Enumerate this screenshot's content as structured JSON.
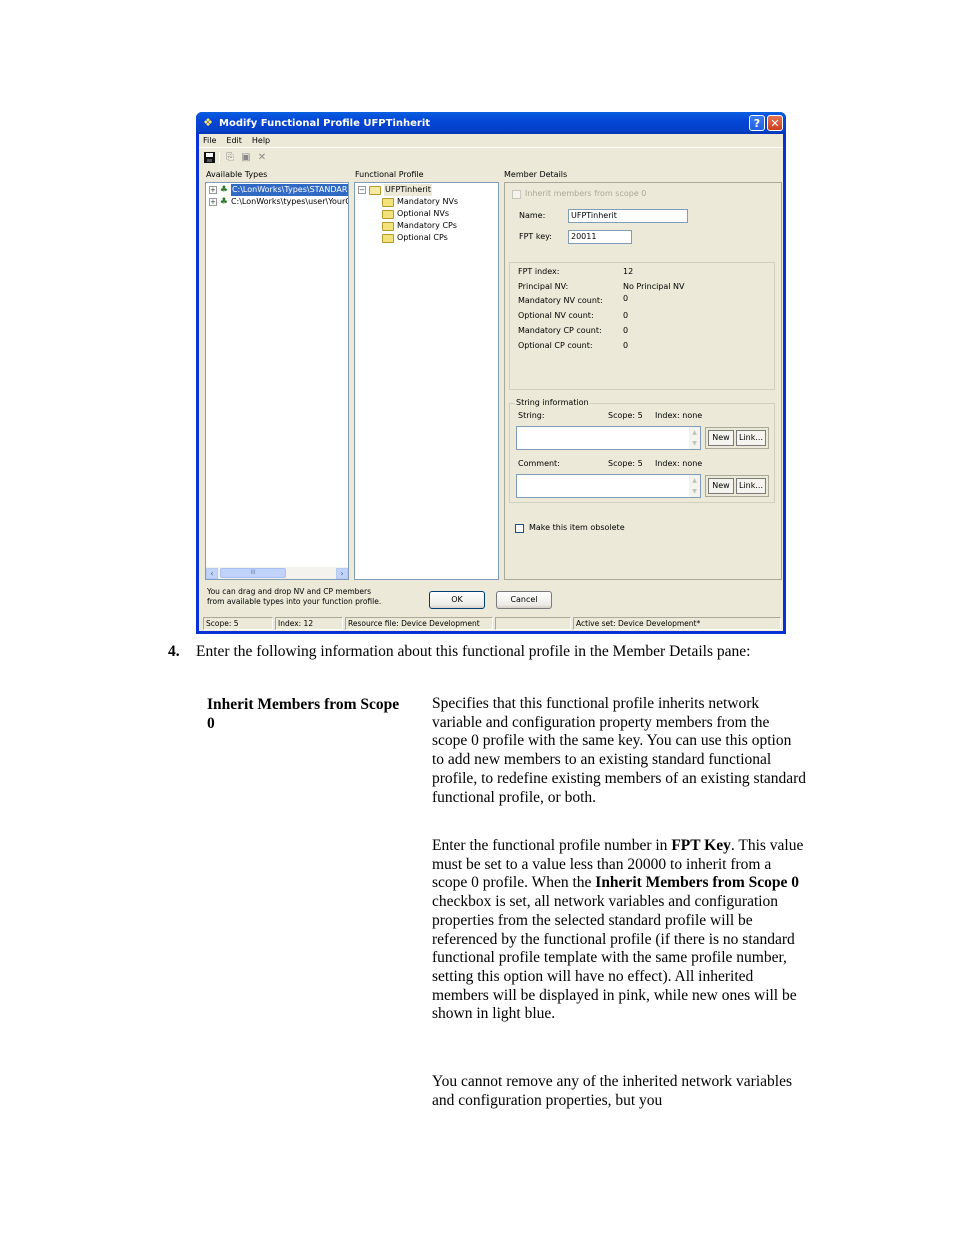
{
  "dialog": {
    "title": "Modify Functional Profile UFPTinherit",
    "title_buttons": {
      "help": "?",
      "close": "✕"
    },
    "menu": [
      "File",
      "Edit",
      "Help"
    ],
    "toolbar_icons": [
      "save-icon",
      "copy-icon",
      "paste-icon",
      "delete-icon"
    ],
    "available_types": {
      "label": "Available Types",
      "items": [
        {
          "expander": "+",
          "text": "C:\\LonWorks\\Types\\STANDAR",
          "selected": true
        },
        {
          "expander": "+",
          "text": "C:\\LonWorks\\types\\user\\YourC",
          "selected": false
        }
      ],
      "scroll_thumb": "III"
    },
    "functional_profile": {
      "label": "Functional Profile",
      "root": {
        "expander": "−",
        "text": "UFPTinherit"
      },
      "children": [
        "Mandatory NVs",
        "Optional NVs",
        "Mandatory CPs",
        "Optional CPs"
      ]
    },
    "member_details": {
      "label": "Member Details",
      "inherit_checkbox": {
        "label": "Inherit members from scope 0",
        "checked": false,
        "enabled": false
      },
      "name_label": "Name:",
      "name_value": "UFPTinherit",
      "fpt_key_label": "FPT key:",
      "fpt_key_value": "20011",
      "info": [
        {
          "label": "FPT index:",
          "value": "12"
        },
        {
          "label": "Principal NV:",
          "value": "No Principal NV"
        },
        {
          "label": "Mandatory NV count:",
          "value": "0"
        },
        {
          "label": "Optional NV count:",
          "value": "0"
        },
        {
          "label": "Mandatory CP count:",
          "value": "0"
        },
        {
          "label": "Optional CP count:",
          "value": "0"
        }
      ],
      "string_info": {
        "title": "String information",
        "string_label": "String:",
        "string_scope": "Scope:  5",
        "string_index": "Index:  none",
        "string_value": "",
        "comment_label": "Comment:",
        "comment_scope": "Scope:  5",
        "comment_index": "Index:  none",
        "comment_value": "",
        "new_label": "New",
        "link_label": "Link..."
      },
      "obsolete_checkbox": {
        "label": "Make this item obsolete",
        "checked": false
      }
    },
    "hint": [
      "You can drag and drop NV and CP members",
      "from available types into your function profile."
    ],
    "ok_label": "OK",
    "cancel_label": "Cancel",
    "status": {
      "scope": "Scope: 5",
      "index": "Index: 12",
      "resource": "Resource file: Device Development",
      "blank": "",
      "active_set": "Active set: Device Development*"
    }
  },
  "document": {
    "step_number": "4.",
    "step_text": "Enter the following information about this functional profile in the Member Details pane:",
    "term": "Inherit Members from Scope 0",
    "para1": "Specifies that this functional profile inherits network variable and configuration property members from the scope 0 profile with the same key.  You can use this option to add new members to an existing standard functional profile, to redefine existing members of an existing standard functional profile, or both.",
    "para2_a": "Enter the functional profile number in ",
    "para2_b": "FPT Key",
    "para2_c": ".  This value must be set to a value less than 20000 to inherit from a scope 0 profile.  When the ",
    "para2_d": "Inherit Members from Scope 0",
    "para2_e": " checkbox is set, all network variables and configuration properties from the selected standard profile will be referenced by the functional profile (if there is no standard functional profile template with the same profile number, setting this option will have no effect).  All inherited members will be displayed in pink, while new ones will be shown in light blue.",
    "para3": "You cannot remove any of the inherited network variables and configuration properties, but you"
  }
}
